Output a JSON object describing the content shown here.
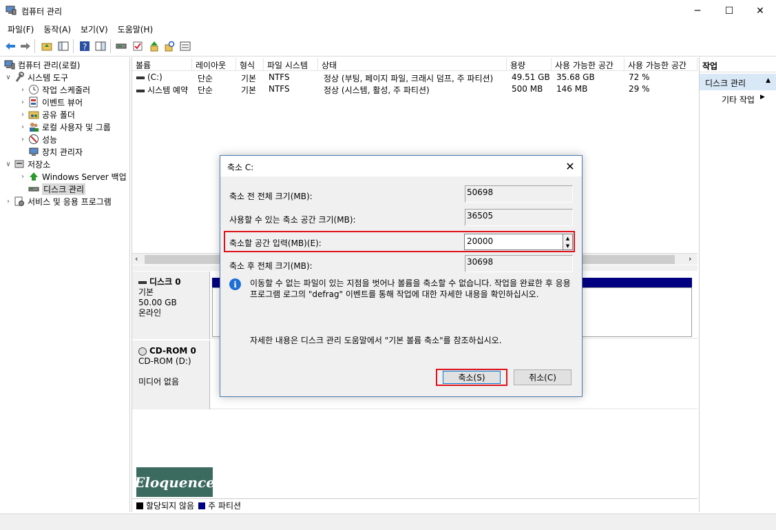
{
  "window": {
    "title": "컴퓨터 관리",
    "minimize": "─",
    "maximize": "☐",
    "close": "✕"
  },
  "menu": [
    "파일(F)",
    "동작(A)",
    "보기(V)",
    "도움말(H)"
  ],
  "tree": {
    "items": [
      {
        "label": "컴퓨터 관리(로컬)",
        "icon": "computer-icon"
      },
      {
        "label": "시스템 도구",
        "icon": "tools-icon"
      },
      {
        "label": "작업 스케줄러",
        "icon": "clock-icon"
      },
      {
        "label": "이벤트 뷰어",
        "icon": "event-viewer-icon"
      },
      {
        "label": "공유 폴더",
        "icon": "shared-folder-icon"
      },
      {
        "label": "로컬 사용자 및 그룹",
        "icon": "users-icon"
      },
      {
        "label": "성능",
        "icon": "performance-icon"
      },
      {
        "label": "장치 관리자",
        "icon": "device-manager-icon"
      },
      {
        "label": "저장소",
        "icon": "storage-icon"
      },
      {
        "label": "Windows Server 백업",
        "icon": "backup-icon"
      },
      {
        "label": "디스크 관리",
        "icon": "disk-icon"
      },
      {
        "label": "서비스 및 응용 프로그램",
        "icon": "services-icon"
      }
    ]
  },
  "volumes": {
    "columns": [
      "볼륨",
      "레이아웃",
      "형식",
      "파일 시스템",
      "상태",
      "용량",
      "사용 가능한 공간",
      "사용 가능한 공간"
    ],
    "rows": [
      {
        "volume": "(C:)",
        "layout": "단순",
        "type": "기본",
        "fs": "NTFS",
        "status": "정상 (부팅, 페이지 파일, 크래시 덤프, 주 파티션)",
        "capacity": "49.51 GB",
        "free": "35.68 GB",
        "pct": "72 %"
      },
      {
        "volume": "시스템 예약",
        "layout": "단순",
        "type": "기본",
        "fs": "NTFS",
        "status": "정상 (시스템, 활성, 주 파티션)",
        "capacity": "500 MB",
        "free": "146 MB",
        "pct": "29 %"
      }
    ]
  },
  "disks": [
    {
      "name": "디스크 0",
      "kind": "기본",
      "size": "50.00 GB",
      "state": "온라인"
    },
    {
      "name": "CD-ROM 0",
      "kind": "CD-ROM (D:)",
      "size": "",
      "state": "미디어 없음"
    }
  ],
  "legend": {
    "unallocated": "할당되지 않음",
    "primary": "주 파티션",
    "unallocated_color": "#000000",
    "primary_color": "#000080"
  },
  "watermark": "Eloquence",
  "actions": {
    "header": "작업",
    "disk_mgmt": "디스크 관리",
    "more": "기타 작업"
  },
  "dialog": {
    "title": "축소 C:",
    "total_before_label": "축소 전 전체 크기(MB):",
    "total_before": "50698",
    "available_label": "사용할 수 있는 축소 공간 크기(MB):",
    "available": "36505",
    "shrink_label": "축소할 공간 입력(MB)(E):",
    "shrink_value": "20000",
    "total_after_label": "축소 후 전체 크기(MB):",
    "total_after": "30698",
    "info": "이동할 수 없는 파일이 있는 지점을 벗어나 볼륨을 축소할 수 없습니다. 작업을 완료한 후 응용 프로그램 로그의 \"defrag\" 이벤트를 통해 작업에 대한 자세한 내용을 확인하십시오.",
    "help": "자세한 내용은 디스크 관리 도움말에서 \"기본 볼륨 축소\"를 참조하십시오.",
    "ok": "축소(S)",
    "cancel": "취소(C)"
  }
}
